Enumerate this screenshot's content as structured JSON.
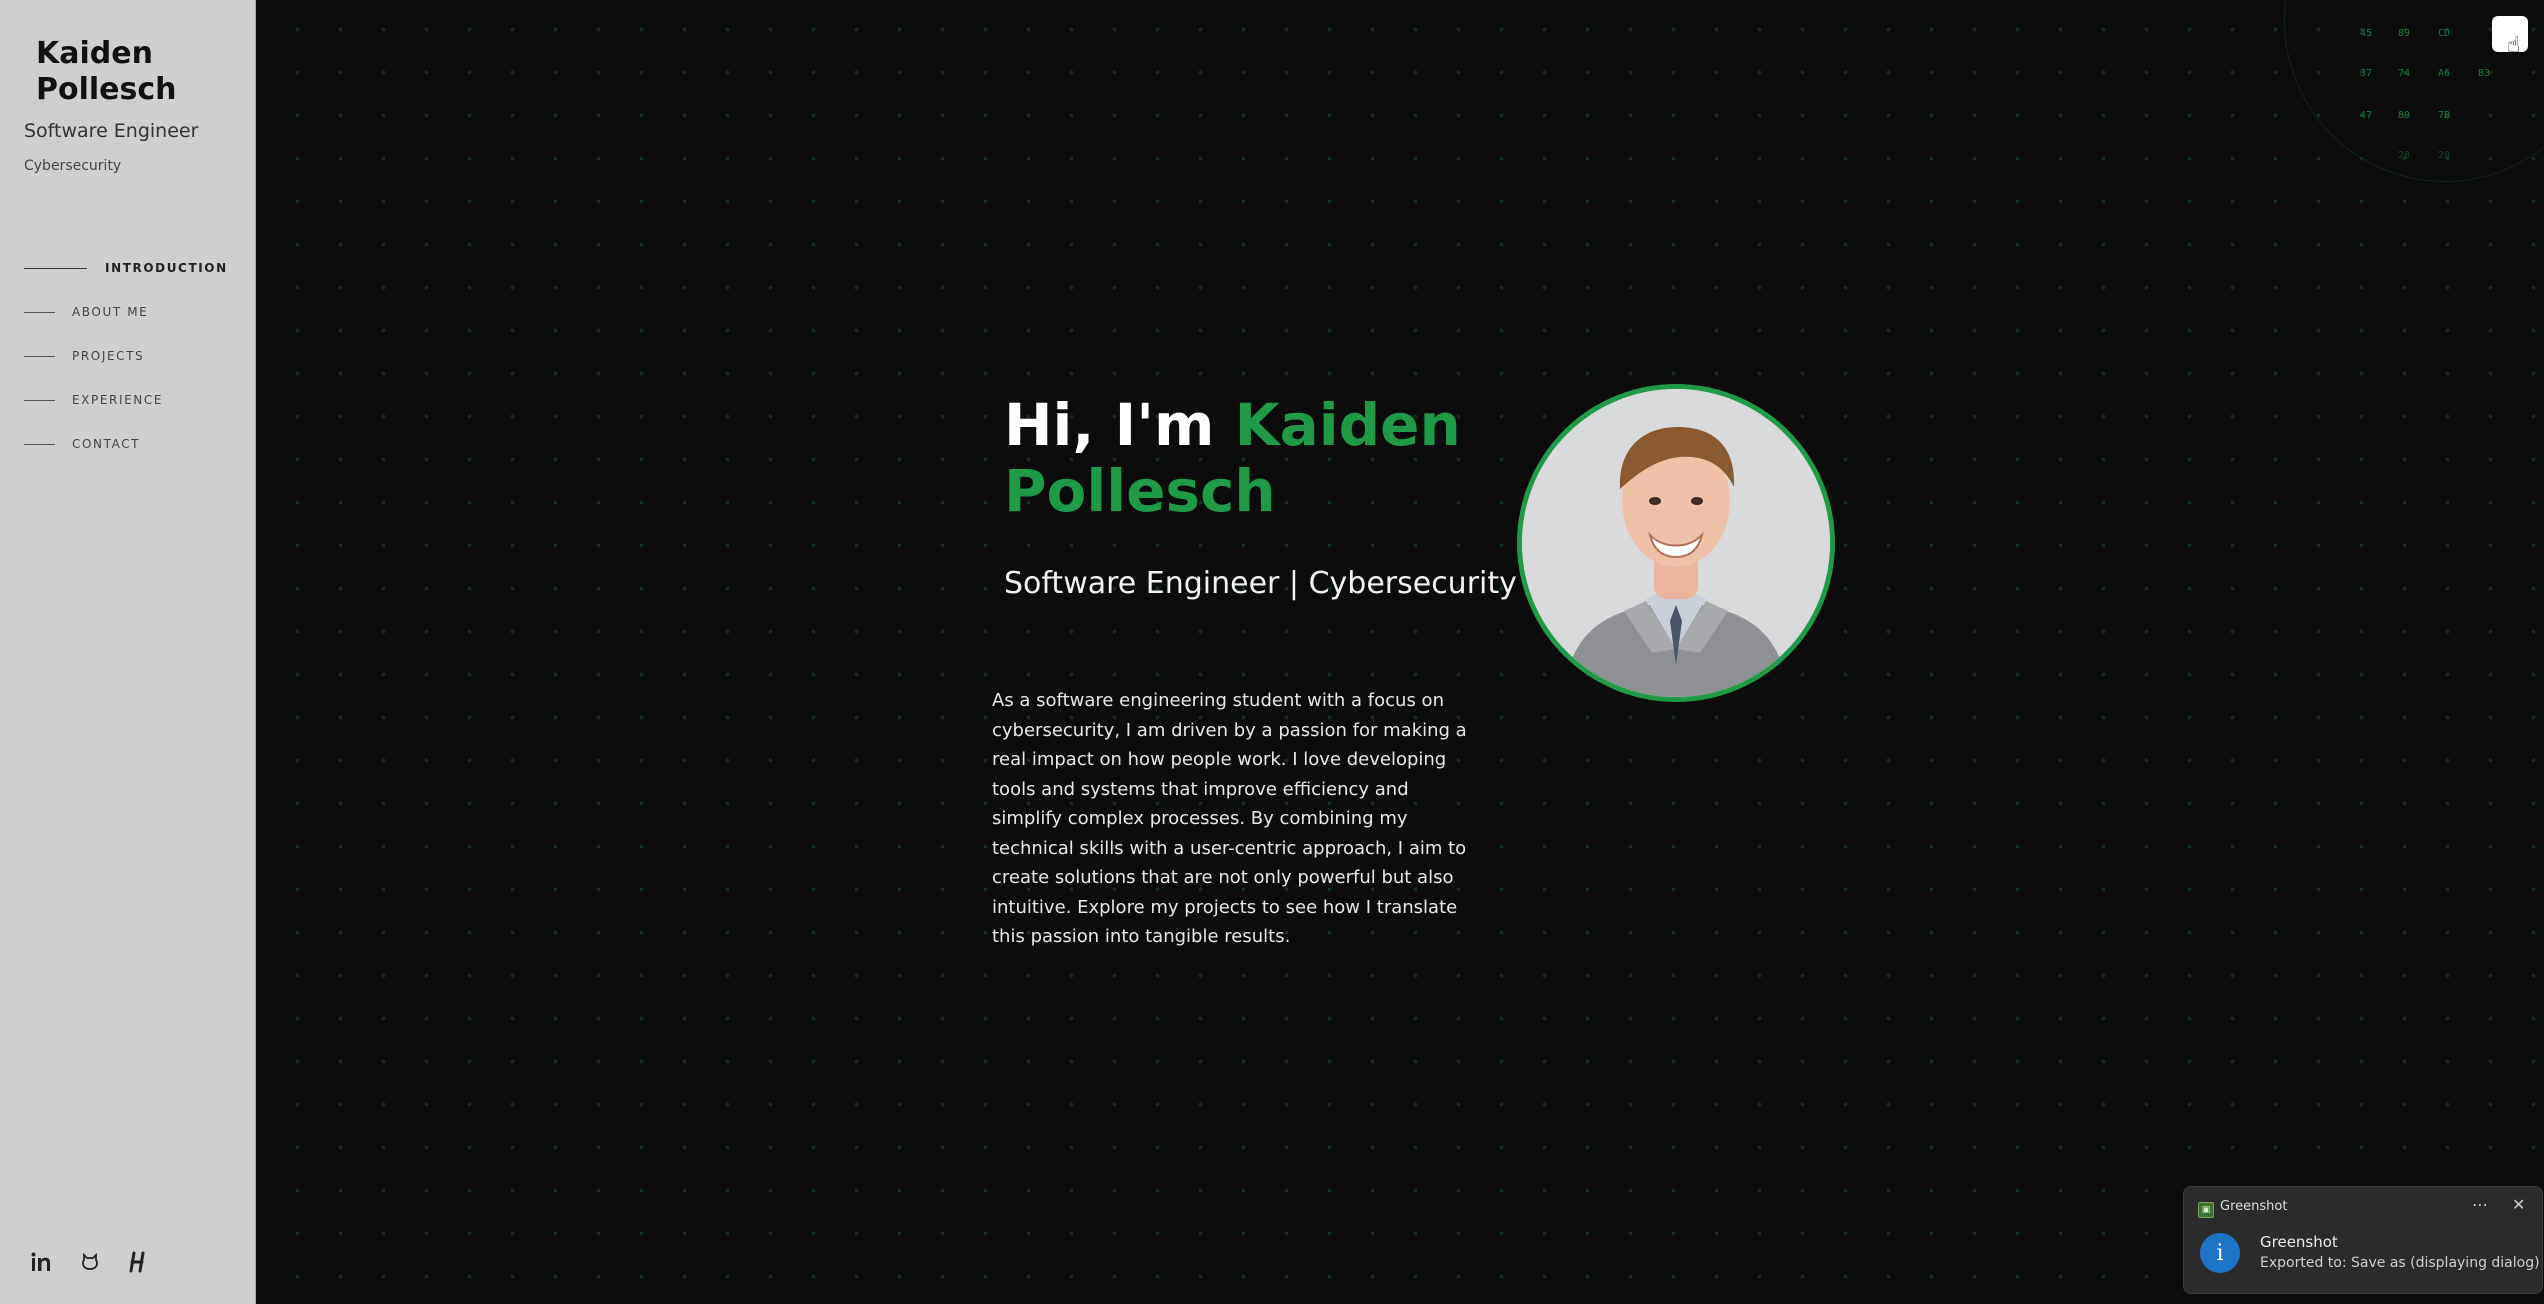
{
  "sidebar": {
    "name": "Kaiden\nPollesch",
    "role": "Software Engineer",
    "sub": "Cybersecurity",
    "nav": [
      {
        "label": "INTRODUCTION",
        "active": true
      },
      {
        "label": "ABOUT ME"
      },
      {
        "label": "PROJECTS"
      },
      {
        "label": "EXPERIENCE"
      },
      {
        "label": "CONTACT"
      }
    ],
    "social": [
      {
        "icon": "linkedin-icon",
        "glyph": "in"
      },
      {
        "icon": "github-icon",
        "glyph": "⌂"
      },
      {
        "icon": "hackerrank-icon",
        "glyph": "H"
      }
    ]
  },
  "hero": {
    "greeting": "Hi, I'm ",
    "name_line1": "Kaiden",
    "name_line2": "Pollesch",
    "subtitle": "Software Engineer | Cybersecurity",
    "body": "As a software engineering student with a focus on cybersecurity, I am driven by a passion for making a real impact on how people work. I love developing tools and systems that improve efficiency and simplify complex processes. By combining my technical skills with a user-centric approach, I aim to create solutions that are not only powerful but also intuitive. Explore my projects to see how I translate this passion into tangible results."
  },
  "hex_values": [
    "45",
    "89",
    "CD",
    "37",
    "74",
    "A6",
    "B3",
    "47",
    "89",
    "7B",
    "28",
    "20"
  ],
  "toast": {
    "app": "Greenshot",
    "title": "Greenshot",
    "message": "Exported to: Save as (displaying dialog)"
  },
  "colors": {
    "accent": "#1f9b48",
    "background": "#0c0c0c",
    "sidebar": "#cfcfcf"
  }
}
